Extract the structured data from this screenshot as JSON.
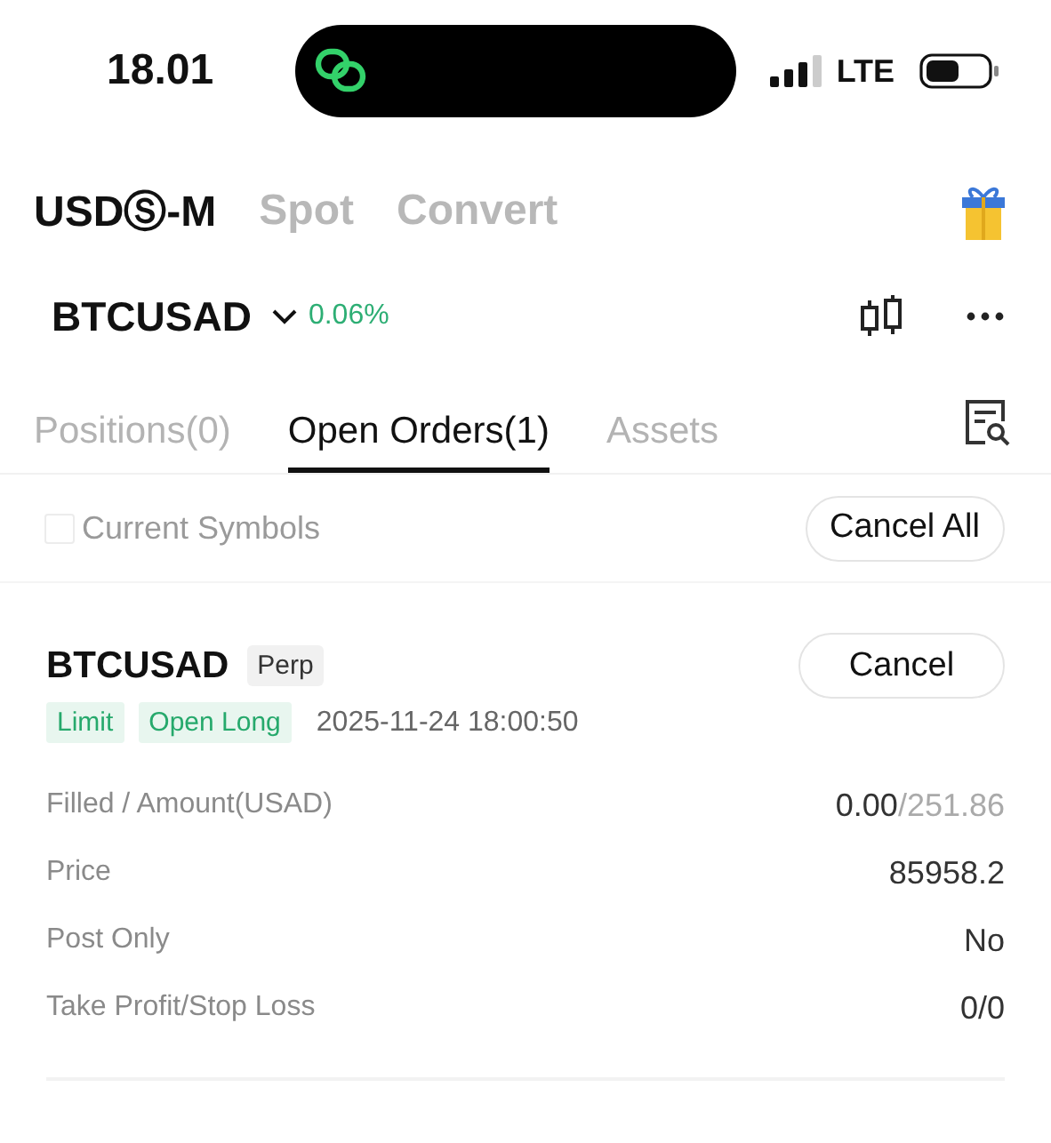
{
  "status_bar": {
    "time": "18.01",
    "network": "LTE"
  },
  "market_tabs": [
    {
      "label": "USDⓈ-M",
      "selected": true
    },
    {
      "label": "Spot",
      "selected": false
    },
    {
      "label": "Convert",
      "selected": false
    }
  ],
  "symbol": {
    "name": "BTCUSAD",
    "change": "0.06%"
  },
  "order_tabs": [
    {
      "label": "Positions(0)",
      "selected": false
    },
    {
      "label": "Open Orders(1)",
      "selected": true
    },
    {
      "label": "Assets",
      "selected": false
    }
  ],
  "filter": {
    "label": "Current Symbols",
    "checked": false,
    "action": "Cancel All"
  },
  "order": {
    "symbol": "BTCUSAD",
    "badge": "Perp",
    "tags": [
      "Limit",
      "Open Long"
    ],
    "time": "2025-11-24 18:00:50",
    "action": "Cancel",
    "fields": [
      {
        "label": "Filled / Amount(USAD)",
        "value": "0.00",
        "total": "/251.86"
      },
      {
        "label": "Price",
        "value": "85958.2"
      },
      {
        "label": "Post Only",
        "value": "No"
      },
      {
        "label": "Take Profit/Stop Loss",
        "value": "0/0"
      }
    ]
  }
}
